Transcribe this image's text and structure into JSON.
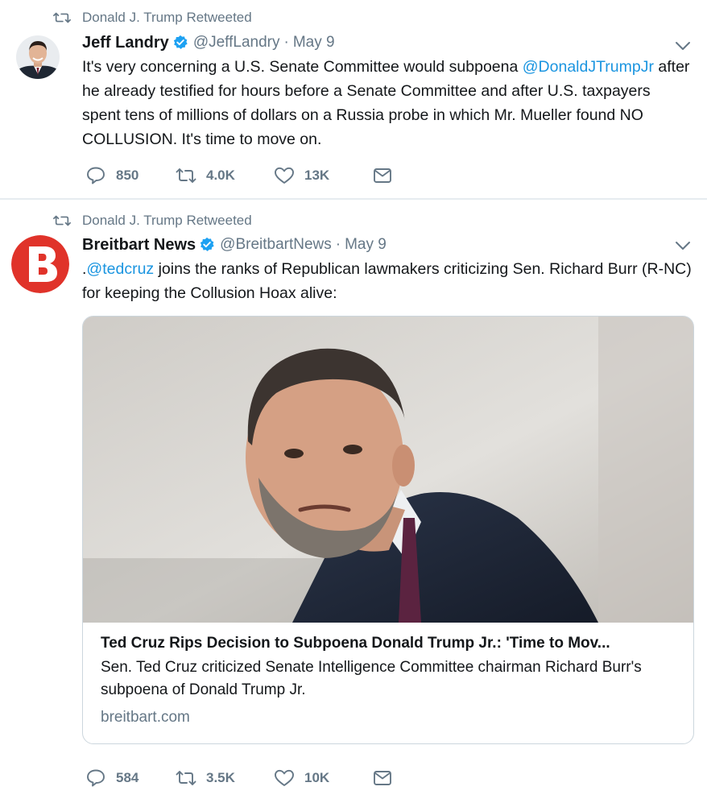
{
  "tweets": [
    {
      "retweet_context": "Donald J. Trump Retweeted",
      "author_name": "Jeff Landry",
      "author_handle": "@JeffLandry",
      "separator": "·",
      "date": "May 9",
      "text_before": "It's very concerning a U.S. Senate Committee would subpoena ",
      "mention": "@DonaldJTrumpJr",
      "text_after": " after he already testified for hours before a Senate Committee and after U.S. taxpayers spent tens of millions of dollars on a  Russia probe in which Mr. Mueller found NO COLLUSION.  It's time to move on.",
      "replies": "850",
      "retweets": "4.0K",
      "likes": "13K"
    },
    {
      "retweet_context": "Donald J. Trump Retweeted",
      "author_name": "Breitbart News",
      "author_handle": "@BreitbartNews",
      "separator": "·",
      "date": "May 9",
      "text_prefix": ".",
      "mention": "@tedcruz",
      "text_after": " joins the ranks of Republican lawmakers criticizing Sen. Richard Burr (R-NC) for keeping the Collusion Hoax alive:",
      "card": {
        "title": "Ted Cruz Rips Decision to Subpoena Donald Trump Jr.: 'Time to Mov...",
        "description": "Sen. Ted Cruz criticized Senate Intelligence Committee chairman Richard Burr's subpoena of Donald Trump Jr.",
        "domain": "breitbart.com"
      },
      "replies": "584",
      "retweets": "3.5K",
      "likes": "10K"
    }
  ],
  "colors": {
    "accent": "#1b95e0",
    "muted": "#657786",
    "breitbart_red": "#e0332a"
  },
  "icons": [
    "retweet-icon",
    "verified-badge-icon",
    "chevron-down-icon",
    "reply-icon",
    "like-icon",
    "direct-message-icon"
  ]
}
